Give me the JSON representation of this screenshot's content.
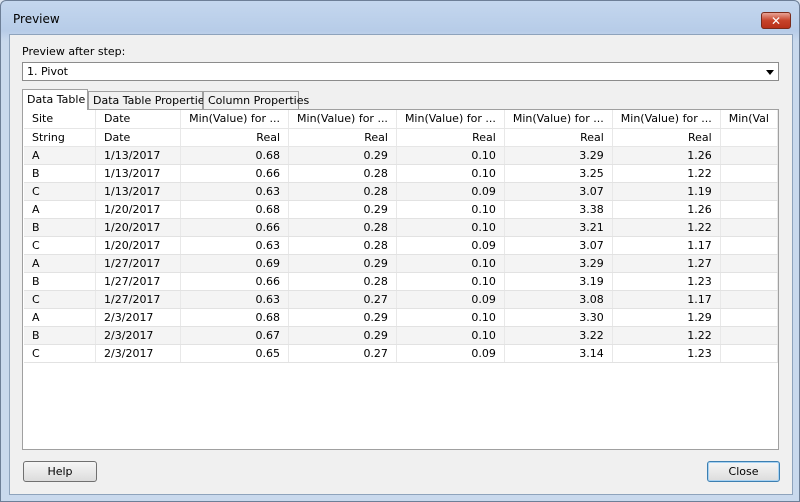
{
  "window": {
    "title": "Preview",
    "close_glyph": "✕"
  },
  "step": {
    "label": "Preview after step:",
    "selected": "1. Pivot"
  },
  "tabs": [
    {
      "label": "Data Table"
    },
    {
      "label": "Data Table Properties"
    },
    {
      "label": "Column Properties"
    }
  ],
  "table": {
    "columns": [
      {
        "name": "Site",
        "type": "String",
        "align": "left"
      },
      {
        "name": "Date",
        "type": "Date",
        "align": "left"
      },
      {
        "name": "Min(Value) for ...",
        "type": "Real",
        "align": "right"
      },
      {
        "name": "Min(Value) for ...",
        "type": "Real",
        "align": "right"
      },
      {
        "name": "Min(Value) for ...",
        "type": "Real",
        "align": "right"
      },
      {
        "name": "Min(Value) for ...",
        "type": "Real",
        "align": "right"
      },
      {
        "name": "Min(Value) for ...",
        "type": "Real",
        "align": "right"
      },
      {
        "name": "Min(Val",
        "type": "",
        "align": "left"
      }
    ],
    "rows": [
      [
        "A",
        "1/13/2017",
        "0.68",
        "0.29",
        "0.10",
        "3.29",
        "1.26",
        ""
      ],
      [
        "B",
        "1/13/2017",
        "0.66",
        "0.28",
        "0.10",
        "3.25",
        "1.22",
        ""
      ],
      [
        "C",
        "1/13/2017",
        "0.63",
        "0.28",
        "0.09",
        "3.07",
        "1.19",
        ""
      ],
      [
        "A",
        "1/20/2017",
        "0.68",
        "0.29",
        "0.10",
        "3.38",
        "1.26",
        ""
      ],
      [
        "B",
        "1/20/2017",
        "0.66",
        "0.28",
        "0.10",
        "3.21",
        "1.22",
        ""
      ],
      [
        "C",
        "1/20/2017",
        "0.63",
        "0.28",
        "0.09",
        "3.07",
        "1.17",
        ""
      ],
      [
        "A",
        "1/27/2017",
        "0.69",
        "0.29",
        "0.10",
        "3.29",
        "1.27",
        ""
      ],
      [
        "B",
        "1/27/2017",
        "0.66",
        "0.28",
        "0.10",
        "3.19",
        "1.23",
        ""
      ],
      [
        "C",
        "1/27/2017",
        "0.63",
        "0.27",
        "0.09",
        "3.08",
        "1.17",
        ""
      ],
      [
        "A",
        "2/3/2017",
        "0.68",
        "0.29",
        "0.10",
        "3.30",
        "1.29",
        ""
      ],
      [
        "B",
        "2/3/2017",
        "0.67",
        "0.29",
        "0.10",
        "3.22",
        "1.22",
        ""
      ],
      [
        "C",
        "2/3/2017",
        "0.65",
        "0.27",
        "0.09",
        "3.14",
        "1.23",
        ""
      ]
    ]
  },
  "buttons": {
    "help": "Help",
    "close": "Close"
  }
}
